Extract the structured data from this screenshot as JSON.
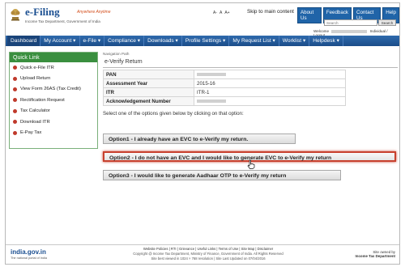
{
  "header": {
    "logo_title": "e-Filing",
    "logo_tagline": "Anywhere Anytime",
    "logo_subtitle": "Income Tax Department, Government of India",
    "font_controls": [
      "A-",
      "A",
      "A+"
    ],
    "skip_link": "Skip to main content",
    "top_links": [
      "About Us",
      "Feedback",
      "Contact Us",
      "Help"
    ],
    "search_placeholder": "Search",
    "search_button": "Search",
    "welcome_prefix": "Welcome",
    "welcome_suffix": "Individual / Logout"
  },
  "nav": {
    "items": [
      "Dashboard",
      "My Account ▾",
      "e-File ▾",
      "Compliance ▾",
      "Downloads ▾",
      "Profile Settings ▾",
      "My Request List ▾",
      "Worklist ▾",
      "Helpdesk ▾"
    ]
  },
  "sidebar": {
    "title": "Quick Link",
    "items": [
      "Quick e-File ITR",
      "Upload Return",
      "View Form 26AS (Tax Credit)",
      "Rectification Request",
      "Tax Calculator",
      "Download ITR",
      "E-Pay Tax"
    ]
  },
  "main": {
    "breadcrumb": "Navigation Path",
    "section_title": "e-Verify Return",
    "rows": [
      {
        "label": "PAN",
        "value": ""
      },
      {
        "label": "Assessment Year",
        "value": "2015-16"
      },
      {
        "label": "ITR",
        "value": "ITR-1"
      },
      {
        "label": "Acknowledgement Number",
        "value": ""
      }
    ],
    "instruction": "Select one of the options given below by clicking on that option:",
    "options": [
      "Option1 - I already have an EVC to e-Verify my return.",
      "Option2 - I do not have an EVC and I would like to generate EVC to e-Verify my return",
      "Option3 - I would like to generate Aadhaar OTP to e-Verify my return"
    ]
  },
  "footer": {
    "logo": "india.gov.in",
    "logo_sub": "The national portal of India",
    "links": "Website Policies | RTI | Grievance | Useful Links | Terms of Use | Site Map | Disclaimer",
    "copyright": "Copyright @ Income Tax Department, Ministry of Finance, Government of India. All Rights Reserved",
    "resolution": "Site best viewed in 1024 × 768 resolution | Site Last Updated on 07/04/2016",
    "owner_line1": "Site owned by",
    "owner_line2": "Income Tax Department"
  },
  "colors": {
    "nav_blue": "#1b4d89",
    "link_blue": "#2064a8",
    "sidebar_green": "#3a8f3f",
    "highlight_red": "#c8412e"
  }
}
